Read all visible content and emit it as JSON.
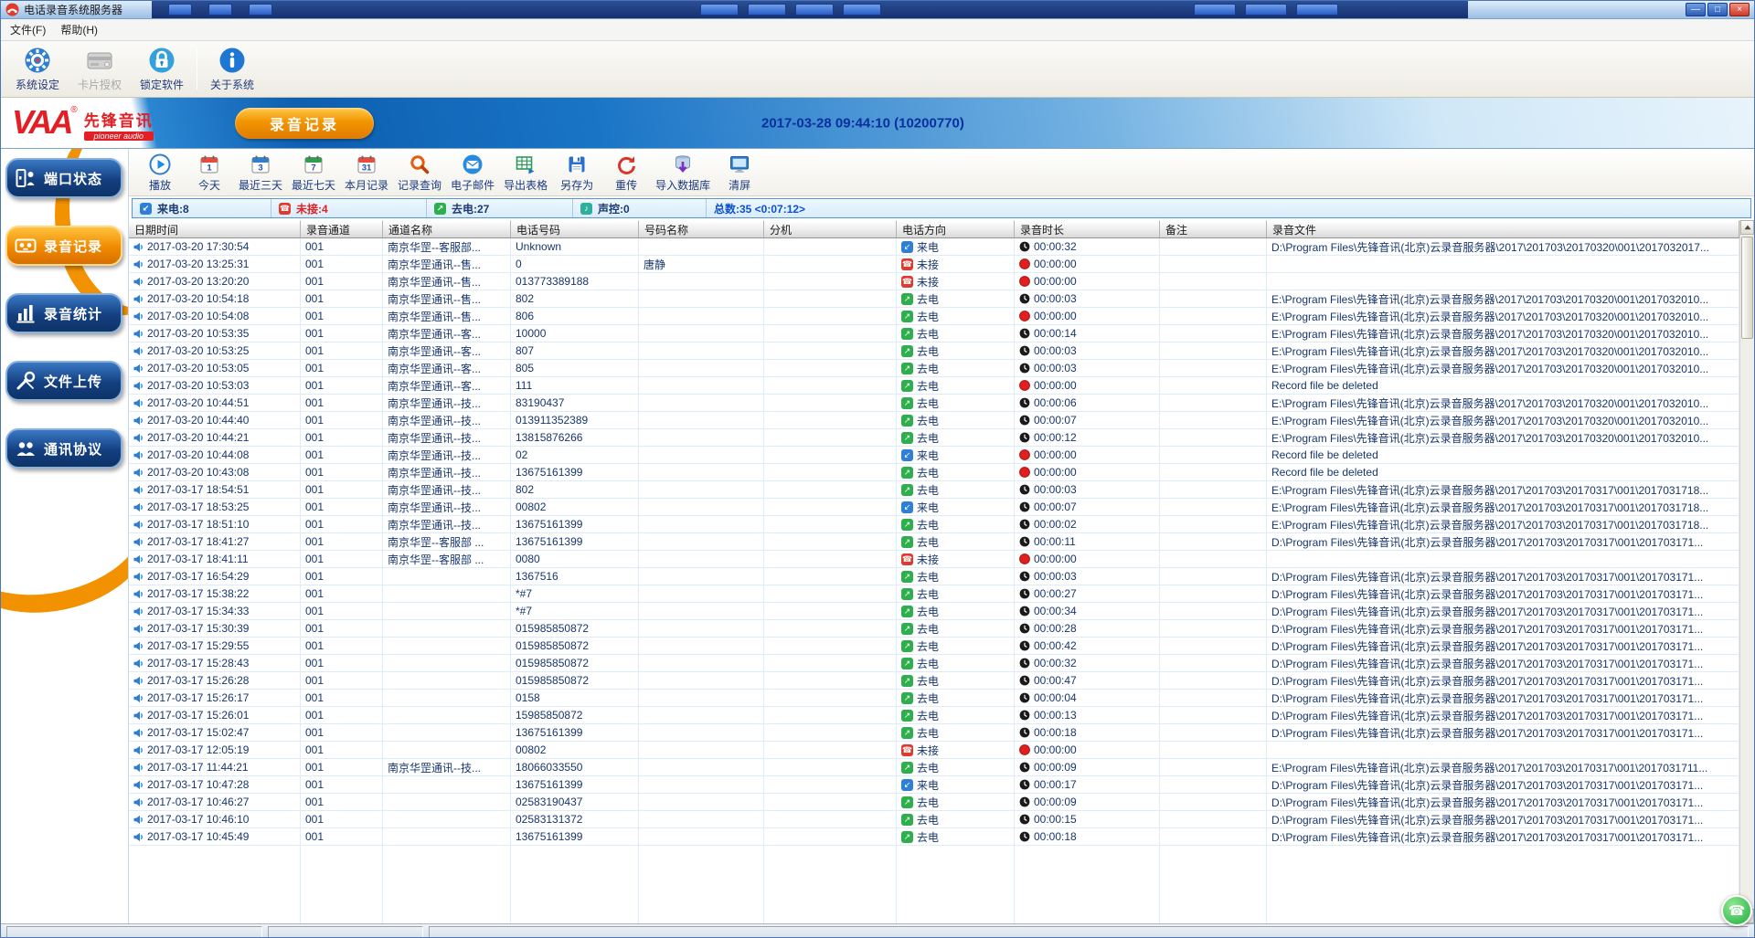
{
  "window": {
    "title": "电话录音系统服务器",
    "datetime": "2017-03-28 09:44:10 (10200770)",
    "controls": {
      "minimize": "—",
      "maximize": "□",
      "close": "×"
    }
  },
  "menu": {
    "items": [
      {
        "label": "文件(F)"
      },
      {
        "label": "帮助(H)"
      }
    ]
  },
  "toolbar": {
    "buttons": [
      {
        "name": "system-settings-button",
        "icon": "gear-icon",
        "label": "系统设定",
        "enabled": true
      },
      {
        "name": "card-authorization-button",
        "icon": "card-icon",
        "label": "卡片授权",
        "enabled": false
      },
      {
        "name": "lock-software-button",
        "icon": "lock-icon",
        "label": "锁定软件",
        "enabled": true
      },
      {
        "name": "about-system-button",
        "icon": "info-icon",
        "label": "关于系统",
        "enabled": true
      }
    ]
  },
  "brand": {
    "logo": "VAA",
    "reg": "®",
    "name": "先锋音讯",
    "sub": "pioneer audio",
    "tab": "录音记录"
  },
  "sidebar": {
    "items": [
      {
        "name": "sidebar-item-port-status",
        "icon": "port-status-icon",
        "label": "端口状态",
        "active": false
      },
      {
        "name": "sidebar-item-record-list",
        "icon": "record-list-icon",
        "label": "录音记录",
        "active": true
      },
      {
        "name": "sidebar-item-record-statistics",
        "icon": "statistics-icon",
        "label": "录音统计",
        "active": false
      },
      {
        "name": "sidebar-item-file-upload",
        "icon": "upload-icon",
        "label": "文件上传",
        "active": false
      },
      {
        "name": "sidebar-item-protocol",
        "icon": "protocol-icon",
        "label": "通讯协议",
        "active": false
      }
    ]
  },
  "toolbar2": {
    "buttons": [
      {
        "name": "play-button",
        "icon": "play-icon",
        "label": "播放"
      },
      {
        "name": "today-button",
        "icon": "calendar-1-icon",
        "label": "今天"
      },
      {
        "name": "last-3-days-button",
        "icon": "calendar-3-icon",
        "label": "最近三天"
      },
      {
        "name": "last-7-days-button",
        "icon": "calendar-7-icon",
        "label": "最近七天"
      },
      {
        "name": "month-records-button",
        "icon": "calendar-month-icon",
        "label": "本月记录"
      },
      {
        "name": "record-query-button",
        "icon": "search-icon",
        "label": "记录查询"
      },
      {
        "name": "email-button",
        "icon": "email-icon",
        "label": "电子邮件"
      },
      {
        "name": "export-table-button",
        "icon": "export-table-icon",
        "label": "导出表格"
      },
      {
        "name": "save-as-button",
        "icon": "save-as-icon",
        "label": "另存为"
      },
      {
        "name": "retransmit-button",
        "icon": "retransmit-icon",
        "label": "重传"
      },
      {
        "name": "import-database-button",
        "icon": "import-db-icon",
        "label": "导入数据库"
      },
      {
        "name": "clear-screen-button",
        "icon": "clear-screen-icon",
        "label": "清屏"
      }
    ]
  },
  "stats": {
    "incoming": "来电:8",
    "missed": "未接:4",
    "outgoing": "去电:27",
    "voice": "声控:0",
    "total": "总数:35 <0:07:12>"
  },
  "icons": {
    "dir-in-icon": {
      "glyph": "↙",
      "color": "#2f7fd6"
    },
    "dir-out-icon": {
      "glyph": "↗",
      "color": "#2fae4e"
    },
    "dir-miss-icon": {
      "glyph": "☎",
      "color": "#e0392e"
    },
    "stat-in-icon": {
      "glyph": "↙",
      "color": "#2f7fd6"
    },
    "stat-miss-icon": {
      "glyph": "☎",
      "color": "#e0392e"
    },
    "stat-out-icon": {
      "glyph": "↗",
      "color": "#2fae4e"
    },
    "stat-voice-icon": {
      "glyph": "♪",
      "color": "#2fae9e"
    }
  },
  "colors": {
    "accent_orange": "#f29000",
    "banner_blue": "#0d5fb0",
    "missed_red": "#e02020",
    "outgoing_green": "#2fae4e",
    "incoming_blue": "#2f7fd6",
    "total_blue": "#0a50d0"
  },
  "table": {
    "columns": [
      "日期时间",
      "录音通道",
      "通道名称",
      "电话号码",
      "号码名称",
      "分机",
      "电话方向",
      "录音时长",
      "备注",
      "录音文件"
    ],
    "direction_labels": {
      "in": "来电",
      "out": "去电",
      "miss": "未接"
    },
    "paths": {
      "D20": "D:\\Program Files\\先锋音讯(北京)云录音服务器\\2017\\201703\\20170320\\001\\2017032017...",
      "E20": "E:\\Program Files\\先锋音讯(北京)云录音服务器\\2017\\201703\\20170320\\001\\2017032010...",
      "E1718": "E:\\Program Files\\先锋音讯(北京)云录音服务器\\2017\\201703\\20170317\\001\\2017031718...",
      "E1711": "E:\\Program Files\\先锋音讯(北京)云录音服务器\\2017\\201703\\20170317\\001\\2017031711...",
      "D17": "D:\\Program Files\\先锋音讯(北京)云录音服务器\\2017\\201703\\20170317\\001\\201703171...",
      "DEL": "Record file be deleted"
    },
    "rows": [
      [
        "2017-03-20 17:30:54",
        "001",
        "南京华罡--客服部...",
        "Unknown",
        "",
        "",
        "in",
        "00:00:32",
        "",
        "D20"
      ],
      [
        "2017-03-20 13:25:31",
        "001",
        "南京华罡通讯--售...",
        "0",
        "唐静",
        "",
        "miss",
        "00:00:00",
        "",
        ""
      ],
      [
        "2017-03-20 13:20:20",
        "001",
        "南京华罡通讯--售...",
        "013773389188",
        "",
        "",
        "miss",
        "00:00:00",
        "",
        ""
      ],
      [
        "2017-03-20 10:54:18",
        "001",
        "南京华罡通讯--售...",
        "802",
        "",
        "",
        "out",
        "00:00:03",
        "",
        "E20"
      ],
      [
        "2017-03-20 10:54:08",
        "001",
        "南京华罡通讯--售...",
        "806",
        "",
        "",
        "out",
        "00:00:00",
        "",
        "E20"
      ],
      [
        "2017-03-20 10:53:35",
        "001",
        "南京华罡通讯--客...",
        "10000",
        "",
        "",
        "out",
        "00:00:14",
        "",
        "E20"
      ],
      [
        "2017-03-20 10:53:25",
        "001",
        "南京华罡通讯--客...",
        "807",
        "",
        "",
        "out",
        "00:00:03",
        "",
        "E20"
      ],
      [
        "2017-03-20 10:53:05",
        "001",
        "南京华罡通讯--客...",
        "805",
        "",
        "",
        "out",
        "00:00:03",
        "",
        "E20"
      ],
      [
        "2017-03-20 10:53:03",
        "001",
        "南京华罡通讯--客...",
        "111",
        "",
        "",
        "out",
        "00:00:00",
        "",
        "DEL"
      ],
      [
        "2017-03-20 10:44:51",
        "001",
        "南京华罡通讯--技...",
        "83190437",
        "",
        "",
        "out",
        "00:00:06",
        "",
        "E20"
      ],
      [
        "2017-03-20 10:44:40",
        "001",
        "南京华罡通讯--技...",
        "013911352389",
        "",
        "",
        "out",
        "00:00:07",
        "",
        "E20"
      ],
      [
        "2017-03-20 10:44:21",
        "001",
        "南京华罡通讯--技...",
        "13815876266",
        "",
        "",
        "out",
        "00:00:12",
        "",
        "E20"
      ],
      [
        "2017-03-20 10:44:08",
        "001",
        "南京华罡通讯--技...",
        "02",
        "",
        "",
        "in",
        "00:00:00",
        "",
        "DEL"
      ],
      [
        "2017-03-20 10:43:08",
        "001",
        "南京华罡通讯--技...",
        "13675161399",
        "",
        "",
        "out",
        "00:00:00",
        "",
        "DEL"
      ],
      [
        "2017-03-17 18:54:51",
        "001",
        "南京华罡通讯--技...",
        "802",
        "",
        "",
        "out",
        "00:00:03",
        "",
        "E1718"
      ],
      [
        "2017-03-17 18:53:25",
        "001",
        "南京华罡通讯--技...",
        "00802",
        "",
        "",
        "in",
        "00:00:07",
        "",
        "E1718"
      ],
      [
        "2017-03-17 18:51:10",
        "001",
        "南京华罡通讯--技...",
        "13675161399",
        "",
        "",
        "out",
        "00:00:02",
        "",
        "E1718"
      ],
      [
        "2017-03-17 18:41:27",
        "001",
        "南京华罡--客服部 ...",
        "13675161399",
        "",
        "",
        "out",
        "00:00:11",
        "",
        "D17"
      ],
      [
        "2017-03-17 18:41:11",
        "001",
        "南京华罡--客服部 ...",
        "0080",
        "",
        "",
        "miss",
        "00:00:00",
        "",
        ""
      ],
      [
        "2017-03-17 16:54:29",
        "001",
        "",
        "1367516",
        "",
        "",
        "out",
        "00:00:03",
        "",
        "D17"
      ],
      [
        "2017-03-17 15:38:22",
        "001",
        "",
        "*#7",
        "",
        "",
        "out",
        "00:00:27",
        "",
        "D17"
      ],
      [
        "2017-03-17 15:34:33",
        "001",
        "",
        "*#7",
        "",
        "",
        "out",
        "00:00:34",
        "",
        "D17"
      ],
      [
        "2017-03-17 15:30:39",
        "001",
        "",
        "015985850872",
        "",
        "",
        "out",
        "00:00:28",
        "",
        "D17"
      ],
      [
        "2017-03-17 15:29:55",
        "001",
        "",
        "015985850872",
        "",
        "",
        "out",
        "00:00:42",
        "",
        "D17"
      ],
      [
        "2017-03-17 15:28:43",
        "001",
        "",
        "015985850872",
        "",
        "",
        "out",
        "00:00:32",
        "",
        "D17"
      ],
      [
        "2017-03-17 15:26:28",
        "001",
        "",
        "015985850872",
        "",
        "",
        "out",
        "00:00:47",
        "",
        "D17"
      ],
      [
        "2017-03-17 15:26:17",
        "001",
        "",
        "0158",
        "",
        "",
        "out",
        "00:00:04",
        "",
        "D17"
      ],
      [
        "2017-03-17 15:26:01",
        "001",
        "",
        "15985850872",
        "",
        "",
        "out",
        "00:00:13",
        "",
        "D17"
      ],
      [
        "2017-03-17 15:02:47",
        "001",
        "",
        "13675161399",
        "",
        "",
        "out",
        "00:00:18",
        "",
        "D17"
      ],
      [
        "2017-03-17 12:05:19",
        "001",
        "",
        "00802",
        "",
        "",
        "miss",
        "00:00:00",
        "",
        ""
      ],
      [
        "2017-03-17 11:44:21",
        "001",
        "南京华罡通讯--技...",
        "18066033550",
        "",
        "",
        "out",
        "00:00:09",
        "",
        "E1711"
      ],
      [
        "2017-03-17 10:47:28",
        "001",
        "",
        "13675161399",
        "",
        "",
        "in",
        "00:00:17",
        "",
        "D17"
      ],
      [
        "2017-03-17 10:46:27",
        "001",
        "",
        "02583190437",
        "",
        "",
        "out",
        "00:00:09",
        "",
        "D17"
      ],
      [
        "2017-03-17 10:46:10",
        "001",
        "",
        "02583131372",
        "",
        "",
        "out",
        "00:00:15",
        "",
        "D17"
      ],
      [
        "2017-03-17 10:45:49",
        "001",
        "",
        "13675161399",
        "",
        "",
        "out",
        "00:00:18",
        "",
        "D17"
      ]
    ]
  }
}
